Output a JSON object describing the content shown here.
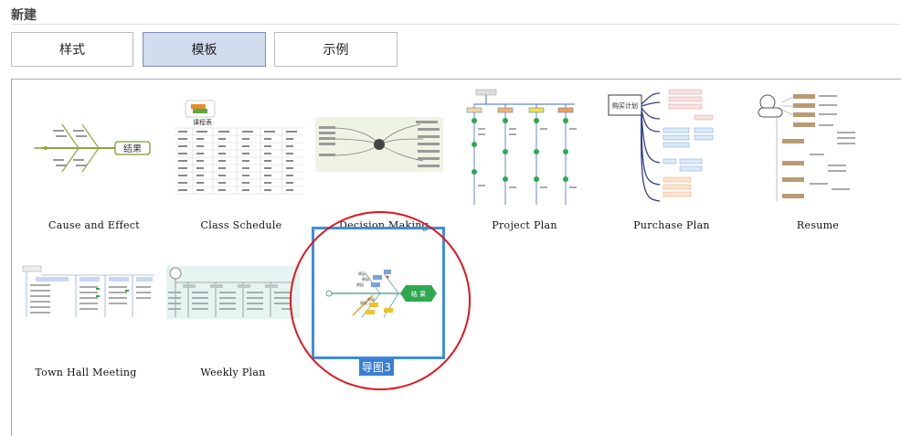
{
  "header": {
    "title": "新建"
  },
  "tabs": [
    {
      "label": "样式"
    },
    {
      "label": "模板"
    },
    {
      "label": "示例"
    }
  ],
  "templates": [
    {
      "name": "Cause and Effect"
    },
    {
      "name": "Class Schedule"
    },
    {
      "name": "Decision Making"
    },
    {
      "name": "Project Plan"
    },
    {
      "name": "Purchase Plan"
    },
    {
      "name": "Resume"
    },
    {
      "name": "Town Hall Meeting"
    },
    {
      "name": "Weekly Plan"
    },
    {
      "name": "导图3"
    }
  ],
  "thumb_text": {
    "fishbone_result": "结果",
    "schedule_title": "课程表",
    "purchase_title": "购买计划",
    "new_map_result": "结 果"
  },
  "colors": {
    "selected_border": "#3d8ee0",
    "active_tab_bg": "#d1dcee",
    "highlight_circle": "#e0161d",
    "fishbone_green": "#2fa84f"
  }
}
